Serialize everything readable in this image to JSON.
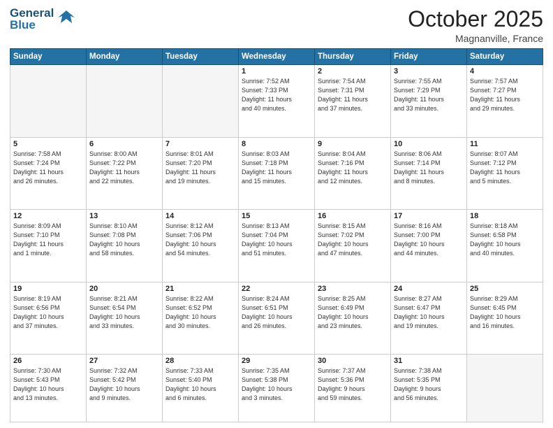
{
  "logo": {
    "line1": "General",
    "line2": "Blue"
  },
  "title": "October 2025",
  "location": "Magnanville, France",
  "days_header": [
    "Sunday",
    "Monday",
    "Tuesday",
    "Wednesday",
    "Thursday",
    "Friday",
    "Saturday"
  ],
  "weeks": [
    [
      {
        "day": "",
        "info": ""
      },
      {
        "day": "",
        "info": ""
      },
      {
        "day": "",
        "info": ""
      },
      {
        "day": "1",
        "info": "Sunrise: 7:52 AM\nSunset: 7:33 PM\nDaylight: 11 hours\nand 40 minutes."
      },
      {
        "day": "2",
        "info": "Sunrise: 7:54 AM\nSunset: 7:31 PM\nDaylight: 11 hours\nand 37 minutes."
      },
      {
        "day": "3",
        "info": "Sunrise: 7:55 AM\nSunset: 7:29 PM\nDaylight: 11 hours\nand 33 minutes."
      },
      {
        "day": "4",
        "info": "Sunrise: 7:57 AM\nSunset: 7:27 PM\nDaylight: 11 hours\nand 29 minutes."
      }
    ],
    [
      {
        "day": "5",
        "info": "Sunrise: 7:58 AM\nSunset: 7:24 PM\nDaylight: 11 hours\nand 26 minutes."
      },
      {
        "day": "6",
        "info": "Sunrise: 8:00 AM\nSunset: 7:22 PM\nDaylight: 11 hours\nand 22 minutes."
      },
      {
        "day": "7",
        "info": "Sunrise: 8:01 AM\nSunset: 7:20 PM\nDaylight: 11 hours\nand 19 minutes."
      },
      {
        "day": "8",
        "info": "Sunrise: 8:03 AM\nSunset: 7:18 PM\nDaylight: 11 hours\nand 15 minutes."
      },
      {
        "day": "9",
        "info": "Sunrise: 8:04 AM\nSunset: 7:16 PM\nDaylight: 11 hours\nand 12 minutes."
      },
      {
        "day": "10",
        "info": "Sunrise: 8:06 AM\nSunset: 7:14 PM\nDaylight: 11 hours\nand 8 minutes."
      },
      {
        "day": "11",
        "info": "Sunrise: 8:07 AM\nSunset: 7:12 PM\nDaylight: 11 hours\nand 5 minutes."
      }
    ],
    [
      {
        "day": "12",
        "info": "Sunrise: 8:09 AM\nSunset: 7:10 PM\nDaylight: 11 hours\nand 1 minute."
      },
      {
        "day": "13",
        "info": "Sunrise: 8:10 AM\nSunset: 7:08 PM\nDaylight: 10 hours\nand 58 minutes."
      },
      {
        "day": "14",
        "info": "Sunrise: 8:12 AM\nSunset: 7:06 PM\nDaylight: 10 hours\nand 54 minutes."
      },
      {
        "day": "15",
        "info": "Sunrise: 8:13 AM\nSunset: 7:04 PM\nDaylight: 10 hours\nand 51 minutes."
      },
      {
        "day": "16",
        "info": "Sunrise: 8:15 AM\nSunset: 7:02 PM\nDaylight: 10 hours\nand 47 minutes."
      },
      {
        "day": "17",
        "info": "Sunrise: 8:16 AM\nSunset: 7:00 PM\nDaylight: 10 hours\nand 44 minutes."
      },
      {
        "day": "18",
        "info": "Sunrise: 8:18 AM\nSunset: 6:58 PM\nDaylight: 10 hours\nand 40 minutes."
      }
    ],
    [
      {
        "day": "19",
        "info": "Sunrise: 8:19 AM\nSunset: 6:56 PM\nDaylight: 10 hours\nand 37 minutes."
      },
      {
        "day": "20",
        "info": "Sunrise: 8:21 AM\nSunset: 6:54 PM\nDaylight: 10 hours\nand 33 minutes."
      },
      {
        "day": "21",
        "info": "Sunrise: 8:22 AM\nSunset: 6:52 PM\nDaylight: 10 hours\nand 30 minutes."
      },
      {
        "day": "22",
        "info": "Sunrise: 8:24 AM\nSunset: 6:51 PM\nDaylight: 10 hours\nand 26 minutes."
      },
      {
        "day": "23",
        "info": "Sunrise: 8:25 AM\nSunset: 6:49 PM\nDaylight: 10 hours\nand 23 minutes."
      },
      {
        "day": "24",
        "info": "Sunrise: 8:27 AM\nSunset: 6:47 PM\nDaylight: 10 hours\nand 19 minutes."
      },
      {
        "day": "25",
        "info": "Sunrise: 8:29 AM\nSunset: 6:45 PM\nDaylight: 10 hours\nand 16 minutes."
      }
    ],
    [
      {
        "day": "26",
        "info": "Sunrise: 7:30 AM\nSunset: 5:43 PM\nDaylight: 10 hours\nand 13 minutes."
      },
      {
        "day": "27",
        "info": "Sunrise: 7:32 AM\nSunset: 5:42 PM\nDaylight: 10 hours\nand 9 minutes."
      },
      {
        "day": "28",
        "info": "Sunrise: 7:33 AM\nSunset: 5:40 PM\nDaylight: 10 hours\nand 6 minutes."
      },
      {
        "day": "29",
        "info": "Sunrise: 7:35 AM\nSunset: 5:38 PM\nDaylight: 10 hours\nand 3 minutes."
      },
      {
        "day": "30",
        "info": "Sunrise: 7:37 AM\nSunset: 5:36 PM\nDaylight: 9 hours\nand 59 minutes."
      },
      {
        "day": "31",
        "info": "Sunrise: 7:38 AM\nSunset: 5:35 PM\nDaylight: 9 hours\nand 56 minutes."
      },
      {
        "day": "",
        "info": ""
      }
    ]
  ]
}
